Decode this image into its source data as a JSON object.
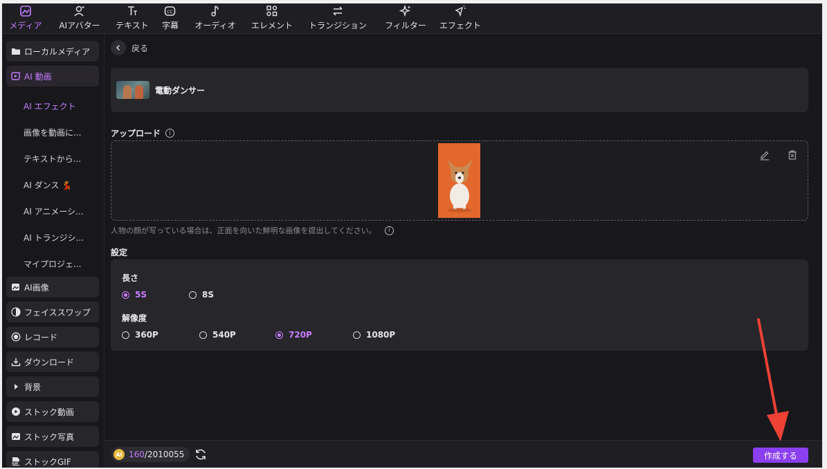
{
  "toolbar": {
    "items": [
      {
        "label": "メディア",
        "icon": "media-icon"
      },
      {
        "label": "AIアバター",
        "icon": "avatar-icon"
      },
      {
        "label": "テキスト",
        "icon": "text-icon"
      },
      {
        "label": "字幕",
        "icon": "caption-icon"
      },
      {
        "label": "オーディオ",
        "icon": "audio-icon"
      },
      {
        "label": "エレメント",
        "icon": "element-icon"
      },
      {
        "label": "トランジション",
        "icon": "transition-icon"
      },
      {
        "label": "フィルター",
        "icon": "filter-icon"
      },
      {
        "label": "エフェクト",
        "icon": "effect-icon"
      }
    ]
  },
  "sidebar": {
    "local_media": "ローカルメディア",
    "ai_video": "AI 動画",
    "sub": [
      "AI エフェクト",
      "画像を動画に...",
      "テキストから...",
      "AI ダンス 💃",
      "AI アニメーシ...",
      "AI トランジシ...",
      "マイプロジェ..."
    ],
    "ai_image": "AI画像",
    "face_swap": "フェイススワップ",
    "record": "レコード",
    "download": "ダウンロード",
    "background": "背景",
    "stock_video": "ストック動画",
    "stock_photo": "ストック写真",
    "stock_gif": "ストックGIF"
  },
  "main": {
    "back_label": "戻る",
    "effect_name": "電動ダンサー",
    "upload_label": "アップロード",
    "hint": "人物の顔が写っている場合は、正面を向いた鮮明な画像を提出してください。",
    "settings_label": "設定",
    "length_label": "長さ",
    "length_options": [
      "5S",
      "8S"
    ],
    "resolution_label": "解像度",
    "resolution_options": [
      "360P",
      "540P",
      "720P",
      "1080P"
    ]
  },
  "bottom": {
    "coin_label": "AI",
    "credits_used": "160",
    "credits_total": "/2010055",
    "create_label": "作成する"
  },
  "colors": {
    "accent": "#c77dff",
    "button": "#8b3ff0",
    "annotation_arrow": "#ef4136"
  }
}
